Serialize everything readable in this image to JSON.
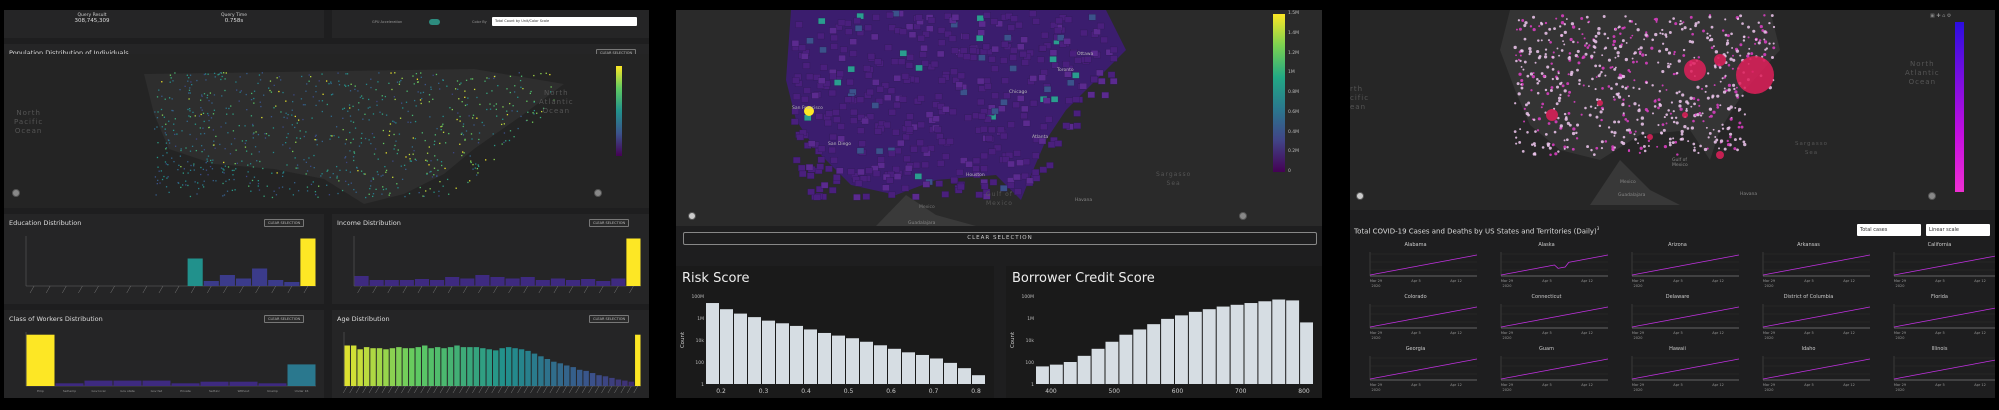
{
  "dashboard1": {
    "query_result_label": "Query Result",
    "query_result_value": "308,745,309",
    "query_time_label": "Query Time",
    "query_time_value": "0.758s",
    "gpu_label": "GPU Acceleration",
    "color_by_label": "Color By",
    "color_by_value": "Total Count by Unit/Color Scale",
    "population_title": "Population Distribution of Individuals",
    "clear_selection": "CLEAR SELECTION",
    "education_title": "Education Distribution",
    "income_title": "Income Distribution",
    "workers_title": "Class of Workers Distribution",
    "age_title": "Age Distribution",
    "ocean_pacific": "North\nPacific\nOcean",
    "ocean_atlantic": "North\nAtlantic\nOcean",
    "education_bars": [
      0,
      0,
      0,
      0,
      0,
      0,
      0,
      0,
      0,
      0,
      55,
      10,
      22,
      15,
      35,
      12,
      8,
      95
    ],
    "income_bars": [
      20,
      12,
      12,
      12,
      14,
      12,
      18,
      15,
      22,
      18,
      15,
      18,
      12,
      15,
      12,
      14,
      10,
      15,
      95
    ],
    "workers_bars": [
      95,
      5,
      10,
      10,
      10,
      5,
      8,
      8,
      5,
      40
    ],
    "workers_labels": [
      "Emp",
      "Self-emp",
      "Gov local",
      "Gov state",
      "Gov fed",
      "Private",
      "Self-inc",
      "Without",
      "Unemp",
      "Under 16"
    ],
    "age_bars": [
      75,
      75,
      68,
      72,
      70,
      70,
      68,
      70,
      72,
      70,
      70,
      72,
      75,
      70,
      72,
      70,
      72,
      75,
      72,
      72,
      72,
      70,
      68,
      66,
      70,
      72,
      70,
      68,
      65,
      60,
      55,
      50,
      45,
      42,
      38,
      35,
      30,
      28,
      24,
      20,
      18,
      15,
      12,
      10,
      8,
      95
    ]
  },
  "dashboard2": {
    "legend_ticks": [
      "1.5M",
      "1.4M",
      "1.2M",
      "1M",
      "0.8M",
      "0.6M",
      "0.4M",
      "0.2M",
      "0"
    ],
    "cities": [
      "Ottawa",
      "Toronto",
      "Chicago",
      "Atlanta",
      "Houston",
      "San Francisco",
      "San Diego"
    ],
    "gulf": "Gulf of\nMexico",
    "sargasso": "Sargasso\nSea",
    "mexico": "Mexico",
    "havana": "Havana",
    "guadalajara": "Guadalajara",
    "clear_selection": "CLEAR SELECTION",
    "risk_title": "Risk Score",
    "credit_title": "Borrower Credit Score",
    "count_label": "Count",
    "risk_y_ticks": [
      "100M",
      "1M",
      "10k",
      "100",
      "1"
    ],
    "risk_x_ticks": [
      "0.2",
      "0.3",
      "0.4",
      "0.5",
      "0.6",
      "0.7",
      "0.8"
    ],
    "risk_bars": [
      92,
      85,
      80,
      76,
      72,
      69,
      66,
      62,
      58,
      55,
      52,
      48,
      44,
      40,
      36,
      33,
      29,
      24,
      18,
      10
    ],
    "credit_y_ticks": [
      "100M",
      "1M",
      "10k",
      "100",
      "1"
    ],
    "credit_x_ticks": [
      "400",
      "500",
      "600",
      "700",
      "800"
    ],
    "credit_bars": [
      20,
      22,
      25,
      32,
      40,
      48,
      56,
      62,
      68,
      74,
      78,
      82,
      85,
      88,
      90,
      92,
      94,
      96,
      95,
      70
    ]
  },
  "dashboard3": {
    "ocean_atlantic": "North\nAtlantic\nOcean",
    "ocean_pacific": "rth\ncific\nean",
    "sargasso": "Sargasso\nSea",
    "covid_title": "Total COVID-19 Cases and Deaths by US States and Territories (Daily)",
    "superscript": "3",
    "select_cases": "Total cases",
    "select_scale": "Linear scale",
    "states": [
      "Alabama",
      "Alaska",
      "Arizona",
      "Arkansas",
      "California",
      "Colorado",
      "Connecticut",
      "Delaware",
      "District of Columbia",
      "Florida",
      "Georgia",
      "Guam",
      "Hawaii",
      "Idaho",
      "Illinois"
    ],
    "x_ticks": [
      "Mar 29",
      "Apr 5",
      "Apr 12"
    ],
    "year": "2020",
    "gulf": "Gulf of\nMexico",
    "mexico": "Mexico",
    "havana": "Havana",
    "guadalajara": "Guadalajara"
  }
}
